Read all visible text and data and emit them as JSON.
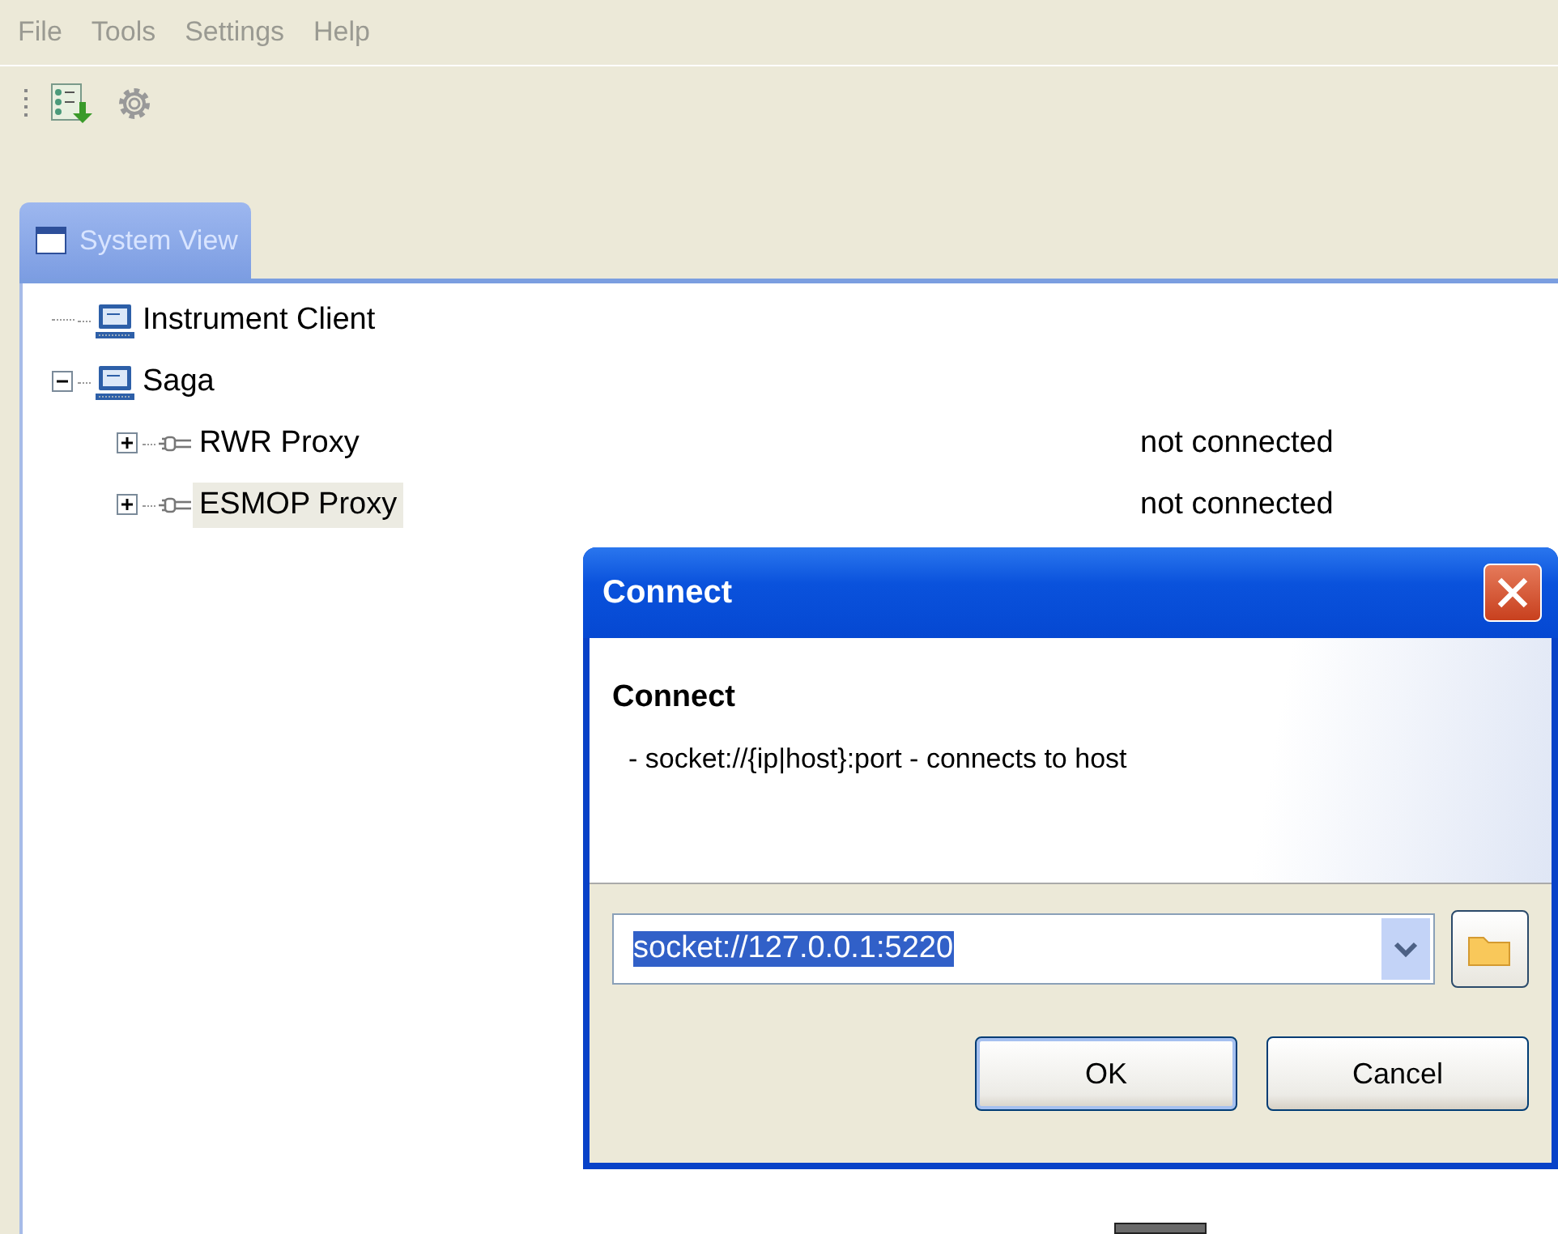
{
  "menu": [
    "File",
    "Tools",
    "Settings",
    "Help"
  ],
  "tabs": [
    {
      "label": "System View",
      "selected": true
    }
  ],
  "tree": [
    {
      "label": "Instrument Client",
      "kind": "computer",
      "selected": false
    },
    {
      "label": "Saga",
      "kind": "computer",
      "expanded": true,
      "selected": false,
      "children": [
        {
          "label": "RWR Proxy",
          "kind": "plug",
          "expanded": false,
          "selected": false,
          "status": "not connected"
        },
        {
          "label": "ESMOP Proxy",
          "kind": "plug",
          "expanded": false,
          "selected": true,
          "status": "not connected"
        }
      ]
    }
  ],
  "dialog": {
    "title": "Connect",
    "heading": "Connect",
    "description": "- socket://{ip|host}:port - connects to host",
    "address": {
      "value": "socket://127.0.0.1:5220",
      "text_selected": true
    },
    "buttons": [
      {
        "label": "OK",
        "default": true
      },
      {
        "label": "Cancel",
        "default": false
      }
    ]
  }
}
